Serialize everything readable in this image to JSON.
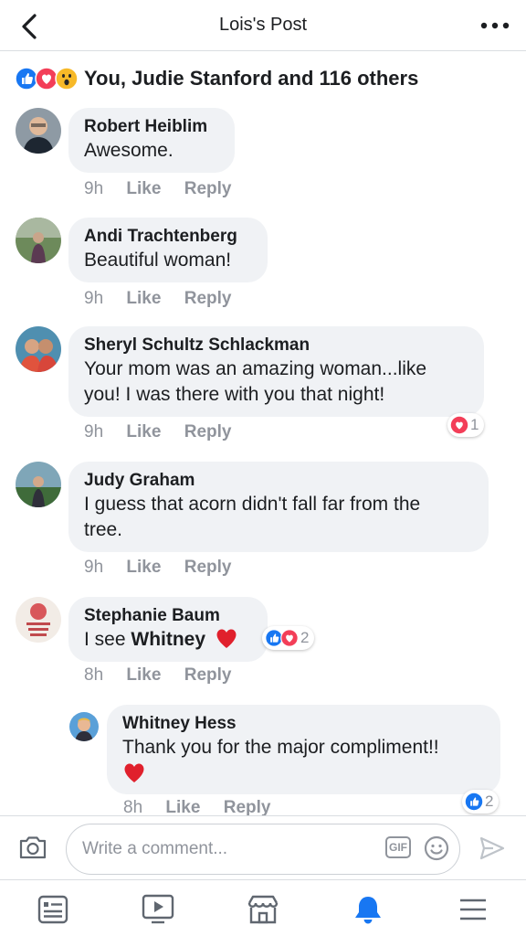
{
  "header": {
    "title": "Lois's Post"
  },
  "reactions_summary": {
    "icons": [
      "like-icon",
      "love-icon",
      "wow-icon"
    ],
    "text": "You, Judie Stanford and 116 others"
  },
  "comments": [
    {
      "author": "Robert Heiblim",
      "text": "Awesome.",
      "time": "9h",
      "like": "Like",
      "reply": "Reply"
    },
    {
      "author": "Andi Trachtenberg",
      "text": "Beautiful woman!",
      "time": "9h",
      "like": "Like",
      "reply": "Reply"
    },
    {
      "author": "Sheryl Schultz Schlackman",
      "line1": "Your mom was an amazing woman...like",
      "line2": "you!  I was there with you that night!",
      "time": "9h",
      "like": "Like",
      "reply": "Reply",
      "reaction_count": "1"
    },
    {
      "author": "Judy Graham",
      "line1": "I guess that acorn didn't fall far from the",
      "line2": "tree.",
      "time": "9h",
      "like": "Like",
      "reply": "Reply"
    },
    {
      "author": "Stephanie Baum",
      "text_prefix": "I see",
      "mention": "Whitney",
      "time": "8h",
      "like": "Like",
      "reply": "Reply",
      "reaction_count": "2"
    },
    {
      "author": "Whitney Hess",
      "text": "Thank you for the major compliment!!",
      "time": "8h",
      "like": "Like",
      "reply": "Reply",
      "reaction_count": "2"
    }
  ],
  "composer": {
    "placeholder": "Write a comment...",
    "gif_label": "GIF"
  },
  "colors": {
    "facebook_blue": "#1877f2",
    "love_red": "#f33e58",
    "wow_yellow": "#f7b928",
    "meta_gray": "#90949c",
    "bubble_bg": "#f0f2f5"
  },
  "tabbar": {
    "items": [
      "news-feed-icon",
      "watch-icon",
      "marketplace-icon",
      "notifications-icon",
      "menu-icon"
    ],
    "active": "notifications-icon"
  }
}
